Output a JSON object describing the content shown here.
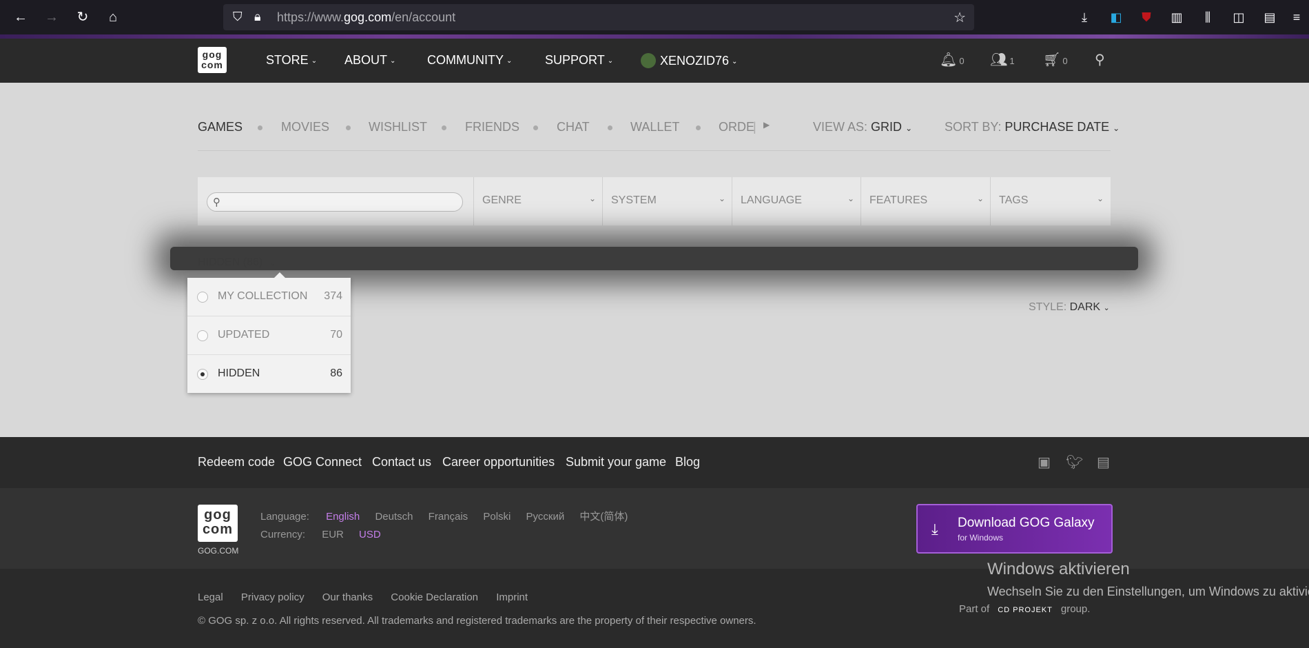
{
  "browser": {
    "url_prefix": "https://www.",
    "url_domain": "gog.com",
    "url_path": "/en/account"
  },
  "header": {
    "logo_text_top": "gog",
    "logo_text_bottom": "com",
    "nav": [
      {
        "label": "STORE"
      },
      {
        "label": "ABOUT"
      },
      {
        "label": "COMMUNITY"
      },
      {
        "label": "SUPPORT"
      }
    ],
    "username": "XENOZID76",
    "notifications_count": "0",
    "friends_count": "1",
    "cart_count": "0"
  },
  "account_tabs": {
    "items": [
      "GAMES",
      "MOVIES",
      "WISHLIST",
      "FRIENDS",
      "CHAT",
      "WALLET",
      "ORDE"
    ],
    "view_as_label": "VIEW AS:",
    "view_as_value": "GRID",
    "sort_by_label": "SORT BY:",
    "sort_by_value": "PURCHASE DATE"
  },
  "filters": {
    "search_placeholder": "",
    "genre": "GENRE",
    "system": "SYSTEM",
    "language": "LANGUAGE",
    "features": "FEATURES",
    "tags": "TAGS"
  },
  "collection_select": {
    "current": "HIDDEN (86)",
    "options": [
      {
        "label": "MY COLLECTION",
        "count": "374"
      },
      {
        "label": "UPDATED",
        "count": "70"
      },
      {
        "label": "HIDDEN",
        "count": "86"
      }
    ]
  },
  "style_select": {
    "label": "STYLE:",
    "value": "DARK"
  },
  "footer": {
    "links": [
      "Redeem code",
      "GOG Connect",
      "Contact us",
      "Career opportunities",
      "Submit your game",
      "Blog"
    ],
    "gog_com": "GOG.COM",
    "language_label": "Language:",
    "languages": [
      "English",
      "Deutsch",
      "Français",
      "Polski",
      "Русский",
      "中文(简体)"
    ],
    "currency_label": "Currency:",
    "currencies": [
      "EUR",
      "USD"
    ],
    "galaxy_title": "Download GOG Galaxy",
    "galaxy_sub": "for Windows",
    "legal_links": [
      "Legal",
      "Privacy policy",
      "Our thanks",
      "Cookie Declaration",
      "Imprint"
    ],
    "copyright": "© GOG sp. z o.o. All rights reserved. All trademarks and registered trademarks are the property of their respective owners.",
    "part_of": "Part of",
    "cd_projekt": "CD PROJEKT",
    "group": "group."
  },
  "windows_activation": {
    "title": "Windows aktivieren",
    "text": "Wechseln Sie zu den Einstellungen, um Windows zu aktivieren."
  },
  "colors": {
    "accent_purple": "#c47ee9",
    "galaxy_button": "#6c27a0"
  }
}
